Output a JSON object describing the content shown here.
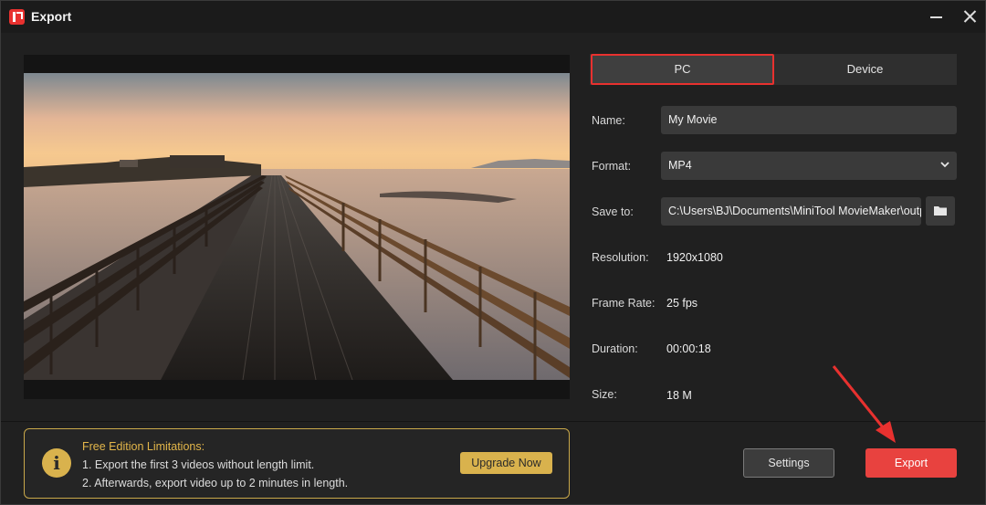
{
  "window": {
    "title": "Export"
  },
  "tabs": [
    {
      "label": "PC",
      "active": true
    },
    {
      "label": "Device",
      "active": false
    }
  ],
  "fields": {
    "name": {
      "label": "Name:",
      "value": "My Movie"
    },
    "format": {
      "label": "Format:",
      "value": "MP4"
    },
    "save_to": {
      "label": "Save to:",
      "value": "C:\\Users\\BJ\\Documents\\MiniTool MovieMaker\\outp"
    },
    "resolution": {
      "label": "Resolution:",
      "value": "1920x1080"
    },
    "frame_rate": {
      "label": "Frame Rate:",
      "value": "25 fps"
    },
    "duration": {
      "label": "Duration:",
      "value": "00:00:18"
    },
    "size": {
      "label": "Size:",
      "value": "18 M"
    }
  },
  "limitations": {
    "title": "Free Edition Limitations:",
    "line1": "1. Export the first 3 videos without length limit.",
    "line2": "2. Afterwards, export video up to 2 minutes in length.",
    "upgrade_label": "Upgrade Now"
  },
  "buttons": {
    "settings_label": "Settings",
    "export_label": "Export"
  },
  "colors": {
    "accent": "#e8423f",
    "gold": "#d9b24d",
    "background": "#202020"
  },
  "icons": {
    "info": "info-icon",
    "folder": "folder-icon",
    "chevron": "chevron-down-icon"
  }
}
